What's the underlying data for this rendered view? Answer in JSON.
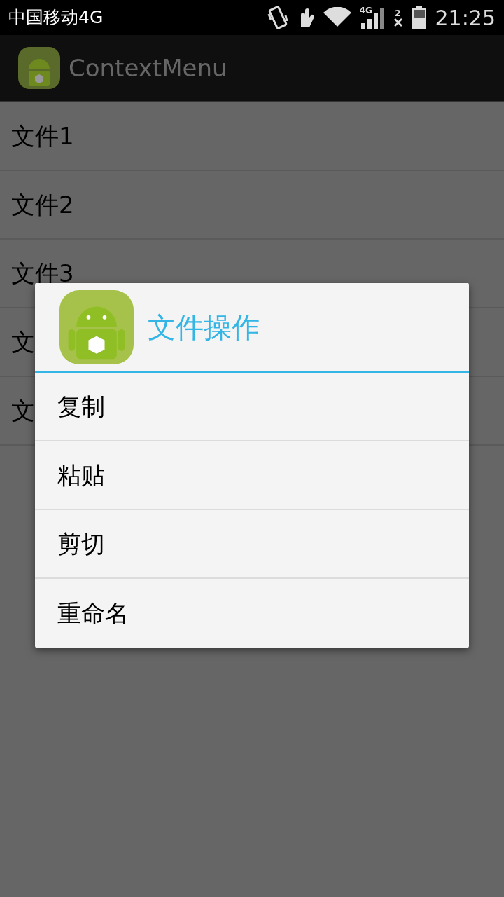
{
  "status_bar": {
    "carrier": "中国移动4G",
    "network_label": "4G",
    "sim_label": "2",
    "time": "21:25"
  },
  "action_bar": {
    "title": "ContextMenu"
  },
  "list": [
    {
      "label": "文件1"
    },
    {
      "label": "文件2"
    },
    {
      "label": "文件3"
    },
    {
      "label": "文"
    },
    {
      "label": "文"
    }
  ],
  "dialog": {
    "title": "文件操作",
    "items": [
      {
        "label": "复制"
      },
      {
        "label": "粘贴"
      },
      {
        "label": "剪切"
      },
      {
        "label": "重命名"
      }
    ]
  }
}
